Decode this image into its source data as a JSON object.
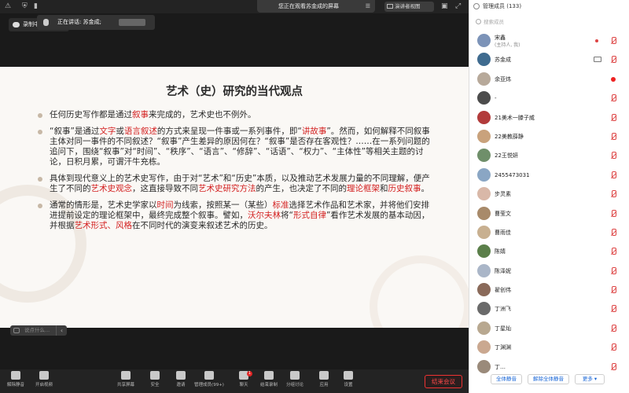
{
  "topbar": {
    "share_banner": "您正在观看苏金成的屏幕",
    "view_label": "演讲者视图"
  },
  "recording": {
    "label": "录制中"
  },
  "slide": {
    "title": "艺术（史）研究的当代观点",
    "paragraphs": [
      [
        {
          "t": "任何历史写作都是通过"
        },
        {
          "t": "叙事",
          "hl": true
        },
        {
          "t": "来完成的，艺术史也不例外。"
        }
      ],
      [
        {
          "t": "“叙事”是通过"
        },
        {
          "t": "文字",
          "hl": true
        },
        {
          "t": "或"
        },
        {
          "t": "语言叙述",
          "hl": true
        },
        {
          "t": "的方式来呈现一件事或一系列事件，即“"
        },
        {
          "t": "讲故事",
          "hl": true
        },
        {
          "t": "”。然而，如何解释不同叙事主体对同一事件的不同叙述？“叙事”产生差异的原因何在？“叙事”是否存在客观性？……在一系列问题的追问下，围绕“叙事”对“时间”、“秩序”、“语言”、“修辞”、“话语”、“权力”、“主体性”等相关主题的讨论，日积月累，可谓汗牛充栋。"
        }
      ],
      [
        {
          "t": "具体到现代意义上的艺术史写作，由于对“艺术”和“历史”本质，以及推动艺术发展力量的不同理解，便产生了不同的"
        },
        {
          "t": "艺术史观念",
          "hl": true
        },
        {
          "t": "，这直接导致不同"
        },
        {
          "t": "艺术史研究方法",
          "hl": true
        },
        {
          "t": "的产生，也决定了不同的"
        },
        {
          "t": "理论框架",
          "hl": true
        },
        {
          "t": "和"
        },
        {
          "t": "历史叙事",
          "hl": true
        },
        {
          "t": "。"
        }
      ],
      [
        {
          "t": "通常的情形是，艺术史学家以"
        },
        {
          "t": "时间",
          "hl": true
        },
        {
          "t": "为线索，按照某一（某些）"
        },
        {
          "t": "标准",
          "hl": true
        },
        {
          "t": "选择艺术作品和艺术家，并将他们安排进提前设定的理论框架中，最终完成整个叙事。譬如，"
        },
        {
          "t": "沃尔夫林",
          "hl": true
        },
        {
          "t": "将“"
        },
        {
          "t": "形式自律",
          "hl": true
        },
        {
          "t": "”看作艺术发展的基本动因，并根据"
        },
        {
          "t": "艺术形式、风格",
          "hl": true
        },
        {
          "t": "在不同时代的演变来叙述艺术的历史。"
        }
      ]
    ]
  },
  "chat": {
    "placeholder": "说点什么..."
  },
  "toolbar": {
    "items": [
      {
        "label": "解除静音",
        "icon": "mic-muted-icon"
      },
      {
        "label": "开启视频",
        "icon": "camera-off-icon"
      },
      {
        "label": "共享屏幕",
        "icon": "share-screen-icon"
      },
      {
        "label": "安全",
        "icon": "shield-icon"
      },
      {
        "label": "邀请",
        "icon": "invite-icon"
      },
      {
        "label": "管理成员(99+)",
        "icon": "members-icon"
      },
      {
        "label": "聊天",
        "icon": "chat-icon",
        "badge": "1"
      },
      {
        "label": "结束录制",
        "icon": "stop-record-icon"
      },
      {
        "label": "分组讨论",
        "icon": "breakout-icon"
      },
      {
        "label": "应用",
        "icon": "apps-icon"
      },
      {
        "label": "设置",
        "icon": "settings-icon"
      }
    ],
    "end_meeting": "结束会议"
  },
  "panel": {
    "title": "管理成员 (133)",
    "speaking": "正在讲话: 苏金成;",
    "search_placeholder": "搜索成员",
    "participants": [
      {
        "name": "宋鑫",
        "sub": "(主持人, 我)",
        "color": "#7c93b8"
      },
      {
        "name": "苏金成",
        "color": "#3f6b8f"
      },
      {
        "name": "余亚炜",
        "color": "#b7a99a"
      },
      {
        "name": "-",
        "color": "#4c4c4c"
      },
      {
        "name": "21美术一滕子威",
        "color": "#b23b3b"
      },
      {
        "name": "22美教薛静",
        "color": "#c9a27c"
      },
      {
        "name": "22王悦妍",
        "color": "#6f8f6a"
      },
      {
        "name": "2455473031",
        "color": "#8aa6c4"
      },
      {
        "name": "步灵素",
        "color": "#d9b8a8"
      },
      {
        "name": "曹莹文",
        "color": "#a88a6a"
      },
      {
        "name": "曹雨佳",
        "color": "#c8b090"
      },
      {
        "name": "陈婧",
        "color": "#5b7f4a"
      },
      {
        "name": "陈泽妮",
        "color": "#aab6c8"
      },
      {
        "name": "翟创伟",
        "color": "#8a6a5a"
      },
      {
        "name": "丁洲飞",
        "color": "#6a6a6a"
      },
      {
        "name": "丁星灿",
        "color": "#b8a890"
      },
      {
        "name": "丁渊渊",
        "color": "#caa890"
      },
      {
        "name": "丁…",
        "color": "#9a8a7a"
      }
    ],
    "footer": {
      "mute_all": "全体静音",
      "unmute_all": "解除全体静音",
      "more": "更多 ▾"
    }
  }
}
